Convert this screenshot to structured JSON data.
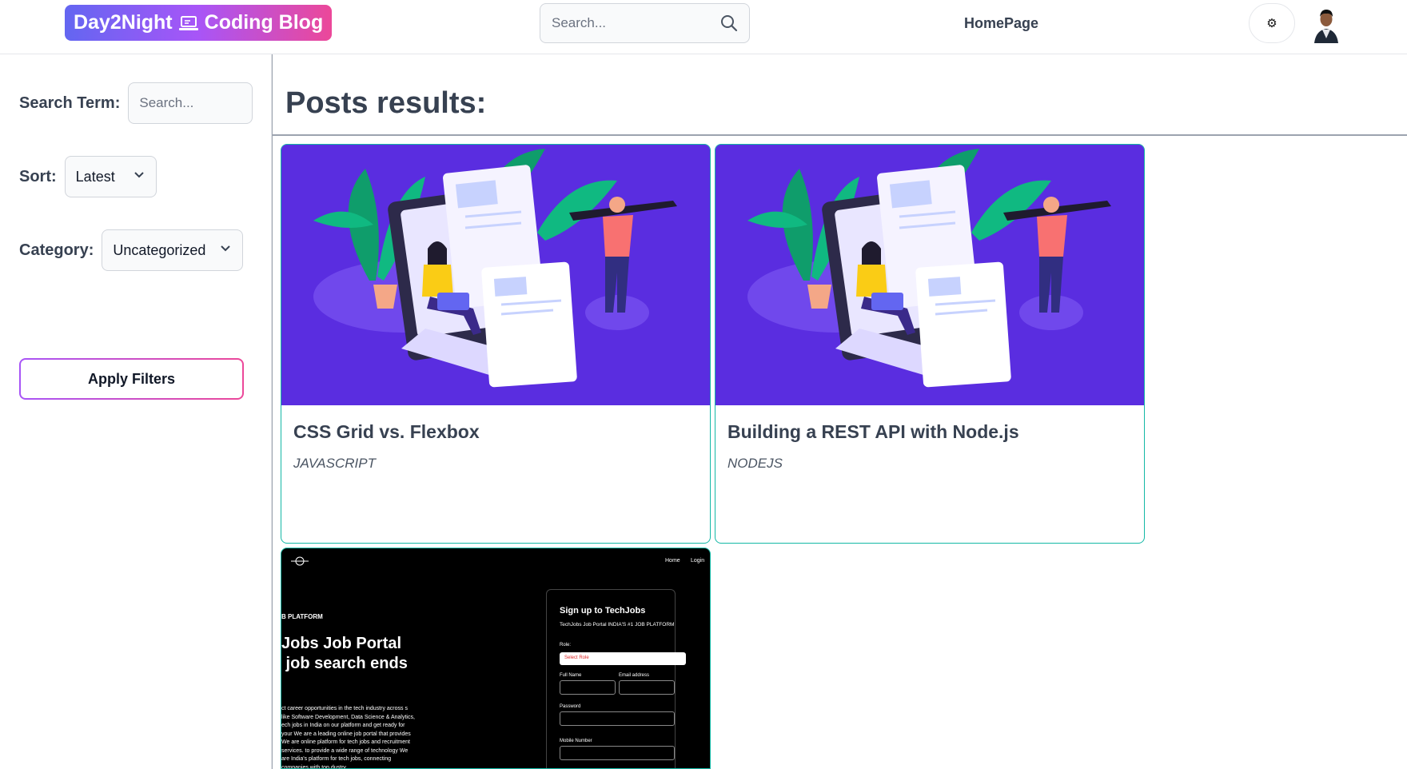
{
  "header": {
    "brand": "Day2Night",
    "brand_suffix": "Coding Blog",
    "search_placeholder": "Search...",
    "nav_home": "HomePage",
    "theme_icon": "gear-icon"
  },
  "sidebar": {
    "search_label": "Search Term:",
    "search_placeholder": "Search...",
    "sort_label": "Sort:",
    "sort_value": "Latest",
    "category_label": "Category:",
    "category_value": "Uncategorized",
    "apply_label": "Apply Filters"
  },
  "main": {
    "title": "Posts results:",
    "posts": [
      {
        "title": "CSS Grid vs. Flexbox",
        "category": "JAVASCRIPT"
      },
      {
        "title": "Building a REST API with Node.js",
        "category": "NODEJS"
      }
    ],
    "preview": {
      "nav_home": "Home",
      "nav_login": "Login",
      "kicker": "B PLATFORM",
      "hero": "Jobs Job Portal\n job search ends",
      "paragraph": "ct career opportunities in the tech industry across s like Software Development, Data Science & Analytics, ech jobs in India on our platform and get ready for your We are a leading online job portal that provides We are online platform for tech jobs and recruitment services. to provide a wide range of technology We are India's platform for tech jobs, connecting companies with top dustry",
      "form_title": "Sign up to TechJobs",
      "form_subtitle": "TechJobs Job Portal INDIA'S #1 JOB PLATFORM",
      "role_label": "Role:",
      "role_placeholder": "Select Role",
      "fullname_label": "Full Name",
      "email_label": "Email address",
      "password_label": "Password",
      "mobile_label": "Mobile Number"
    }
  },
  "colors": {
    "brand_gradient_start": "#6366f1",
    "brand_gradient_end": "#ec4899",
    "card_border": "#14b8a6",
    "thumb_bg": "#5a2de0"
  }
}
